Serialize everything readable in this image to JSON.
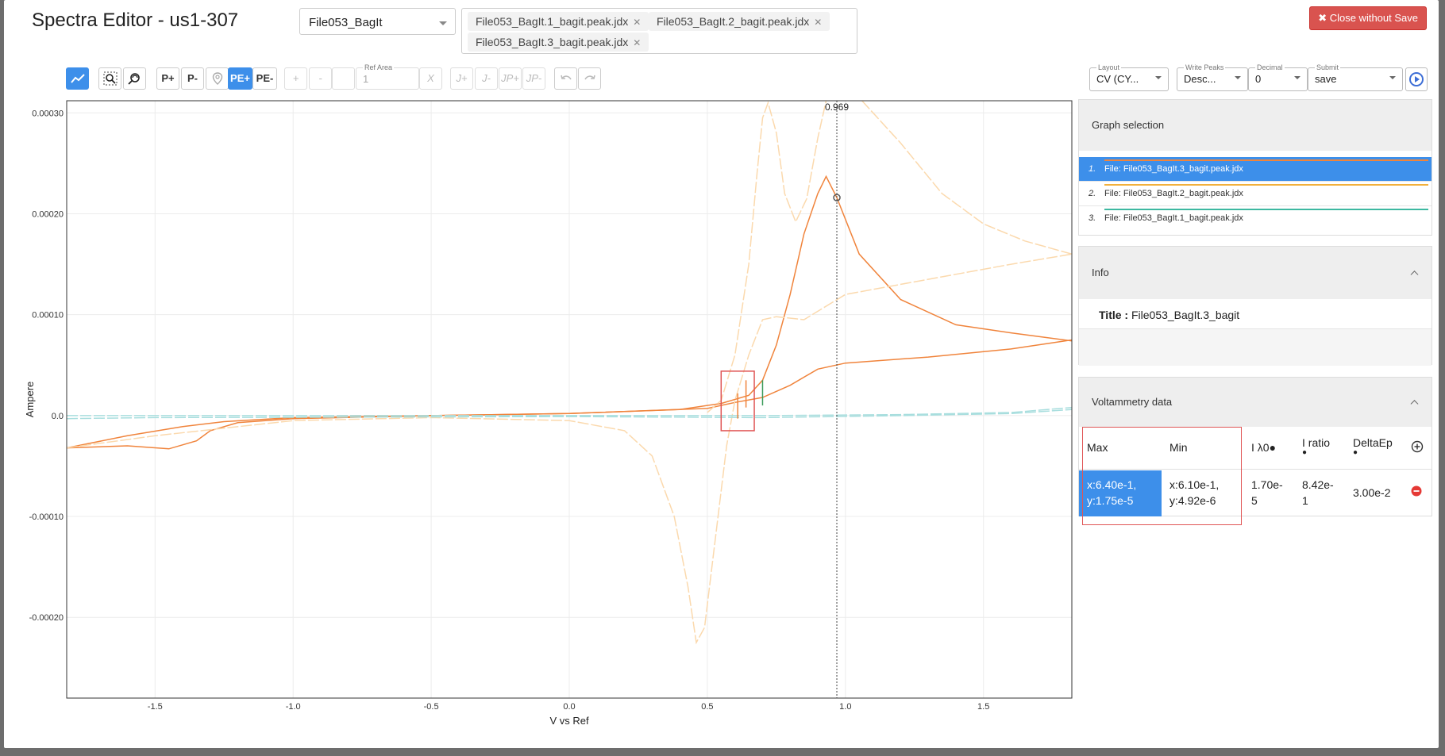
{
  "header": {
    "title": "Spectra Editor - us1-307",
    "close_label": "✖ Close without Save"
  },
  "file_select": {
    "value": "File053_BagIt"
  },
  "files": [
    "File053_BagIt.1_bagit.peak.jdx",
    "File053_BagIt.2_bagit.peak.jdx",
    "File053_BagIt.3_bagit.peak.jdx"
  ],
  "toolbar": {
    "p_plus": "P+",
    "p_minus": "P-",
    "pe_plus": "PE+",
    "pe_minus": "PE-",
    "plus": "+",
    "minus": "-",
    "ref_area_label": "Ref Area",
    "ref_area_value": "1",
    "x_label": "X",
    "j_plus": "J+",
    "j_minus": "J-",
    "jp_plus": "JP+",
    "jp_minus": "JP-"
  },
  "controls": {
    "layout_label": "Layout",
    "layout_value": "CV (CY...",
    "write_peaks_label": "Write Peaks",
    "write_peaks_value": "Desc...",
    "decimal_label": "Decimal",
    "decimal_value": "0",
    "submit_label": "Submit",
    "submit_value": "save"
  },
  "chart_data": {
    "type": "line",
    "xlabel": "V vs Ref",
    "ylabel": "Ampere",
    "xlim": [
      -1.82,
      1.82
    ],
    "ylim": [
      -0.00028,
      0.000312
    ],
    "x_ticks": [
      "-1.5",
      "-1.0",
      "-0.5",
      "0.0",
      "0.5",
      "1.0",
      "1.5"
    ],
    "x_tick_values": [
      -1.5,
      -1.0,
      -0.5,
      0.0,
      0.5,
      1.0,
      1.5
    ],
    "y_ticks": [
      "0.00030",
      "0.00020",
      "0.00010",
      "0.0",
      "-0.00010",
      "-0.00020"
    ],
    "y_tick_values": [
      0.0003,
      0.0002,
      0.0001,
      0.0,
      -0.0001,
      -0.0002
    ],
    "cursor_label": "0.969",
    "cursor_x": 0.969,
    "cursor_point": [
      0.969,
      0.000216
    ],
    "series": [
      {
        "color": "#f0843c",
        "points": [
          [
            -1.82,
            -3.2e-05
          ],
          [
            -1.6,
            -2e-05
          ],
          [
            -1.4,
            -1.1e-05
          ],
          [
            -1.25,
            -6e-06
          ],
          [
            -1.0,
            -2e-06
          ],
          [
            -0.5,
            0.0
          ],
          [
            0.0,
            2e-06
          ],
          [
            0.4,
            6e-06
          ],
          [
            0.55,
            1.2e-05
          ],
          [
            0.65,
            2e-05
          ],
          [
            0.7,
            3.5e-05
          ],
          [
            0.75,
            7e-05
          ],
          [
            0.8,
            0.00012
          ],
          [
            0.85,
            0.00018
          ],
          [
            0.9,
            0.00022
          ],
          [
            0.93,
            0.000237
          ],
          [
            0.969,
            0.000216
          ],
          [
            1.05,
            0.00016
          ],
          [
            1.2,
            0.000115
          ],
          [
            1.4,
            9e-05
          ],
          [
            1.6,
            8.2e-05
          ],
          [
            1.82,
            7.4e-05
          ]
        ]
      },
      {
        "color": "#f0843c",
        "points": [
          [
            -1.82,
            -3.2e-05
          ],
          [
            -1.6,
            -3e-05
          ],
          [
            -1.45,
            -3.3e-05
          ],
          [
            -1.35,
            -2.5e-05
          ],
          [
            -1.3,
            -1.5e-05
          ],
          [
            -1.2,
            -7e-06
          ],
          [
            -1.0,
            -3e-06
          ],
          [
            -0.5,
            0.0
          ],
          [
            0.0,
            2e-06
          ],
          [
            0.5,
            7e-06
          ],
          [
            0.6,
            1.3e-05
          ],
          [
            0.7,
            1.8e-05
          ],
          [
            0.8,
            3e-05
          ],
          [
            0.9,
            4.6e-05
          ],
          [
            1.0,
            5.2e-05
          ],
          [
            1.3,
            5.8e-05
          ],
          [
            1.6,
            6.6e-05
          ],
          [
            1.82,
            7.5e-05
          ]
        ]
      },
      {
        "color": "#fbd9ad",
        "points": [
          [
            -1.82,
            -3.2e-05
          ],
          [
            -1.5,
            -2e-05
          ],
          [
            -1.0,
            -5e-06
          ],
          [
            -0.5,
            -2e-06
          ],
          [
            0.0,
            -5e-06
          ],
          [
            0.2,
            -1.5e-05
          ],
          [
            0.3,
            -4e-05
          ],
          [
            0.38,
            -0.0001
          ],
          [
            0.43,
            -0.00017
          ],
          [
            0.46,
            -0.000225
          ],
          [
            0.49,
            -0.00021
          ],
          [
            0.53,
            -0.00012
          ],
          [
            0.57,
            -3e-05
          ],
          [
            0.6,
            1.5e-05
          ],
          [
            0.65,
            6e-05
          ],
          [
            0.7,
            9.5e-05
          ],
          [
            0.75,
            9.8e-05
          ],
          [
            0.85,
            9.5e-05
          ],
          [
            1.0,
            0.00012
          ],
          [
            1.3,
            0.000135
          ],
          [
            1.6,
            0.00015
          ],
          [
            1.82,
            0.00016
          ]
        ]
      },
      {
        "color": "#fbd9ad",
        "points": [
          [
            0.5,
            3e-06
          ],
          [
            0.55,
            1.5e-05
          ],
          [
            0.6,
            6e-05
          ],
          [
            0.65,
            0.00015
          ],
          [
            0.68,
            0.00024
          ],
          [
            0.7,
            0.000295
          ],
          [
            0.72,
            0.00031
          ],
          [
            0.75,
            0.00028
          ],
          [
            0.78,
            0.00022
          ],
          [
            0.82,
            0.000192
          ],
          [
            0.86,
            0.000215
          ],
          [
            0.9,
            0.000275
          ],
          [
            0.93,
            0.000312
          ]
        ]
      },
      {
        "color": "#fbd9ad",
        "points": [
          [
            1.06,
            0.000312
          ],
          [
            1.2,
            0.00027
          ],
          [
            1.35,
            0.00022
          ],
          [
            1.5,
            0.00019
          ],
          [
            1.65,
            0.000173
          ],
          [
            1.82,
            0.00016
          ]
        ]
      },
      {
        "color": "#a8dede",
        "points": [
          [
            -1.82,
            0.0
          ],
          [
            -1.5,
            0.0
          ],
          [
            0.0,
            0.0
          ],
          [
            0.7,
            0.0
          ],
          [
            1.2,
            1e-06
          ],
          [
            1.6,
            3e-06
          ],
          [
            1.82,
            8e-06
          ]
        ]
      },
      {
        "color": "#a8dede",
        "points": [
          [
            -1.82,
            -3e-06
          ],
          [
            -1.5,
            -2e-06
          ],
          [
            0.0,
            -1e-06
          ],
          [
            0.7,
            -2e-06
          ],
          [
            1.2,
            0.0
          ],
          [
            1.6,
            2e-06
          ],
          [
            1.82,
            6e-06
          ]
        ]
      }
    ],
    "peak_marks": [
      {
        "x": 0.61,
        "y_range": [
          -3e-06,
          2.2e-05
        ],
        "color": "#f0843c"
      },
      {
        "x": 0.64,
        "y_range": [
          8e-06,
          3.5e-05
        ],
        "color": "#f0843c"
      },
      {
        "x": 0.7,
        "y_range": [
          1e-05,
          3.5e-05
        ],
        "color": "#3a9a5a"
      }
    ],
    "highlight_box": {
      "x_range": [
        0.55,
        0.67
      ],
      "y_range": [
        -1.5e-05,
        4.4e-05
      ]
    }
  },
  "graph_selection": {
    "title": "Graph selection",
    "items": [
      {
        "num": "1.",
        "label": "File: File053_BagIt.3_bagit.peak.jdx",
        "color": "#f0843c"
      },
      {
        "num": "2.",
        "label": "File: File053_BagIt.2_bagit.peak.jdx",
        "color": "#f2b13c"
      },
      {
        "num": "3.",
        "label": "File: File053_BagIt.1_bagit.peak.jdx",
        "color": "#3db8a0"
      }
    ]
  },
  "info": {
    "title": "Info",
    "title_key": "Title :",
    "title_value": "File053_BagIt.3_bagit"
  },
  "voltammetry": {
    "title": "Voltammetry data",
    "headers": {
      "max": "Max",
      "min": "Min",
      "i_lambda": "I λ0●",
      "i_ratio": "I ratio",
      "delta_ep": "DeltaEp",
      "dot": "●"
    },
    "row": {
      "max_1": "x:6.40e-1,",
      "max_2": "y:1.75e-5",
      "min_1": "x:6.10e-1,",
      "min_2": "y:4.92e-6",
      "il_1": "1.70e-",
      "il_2": "5",
      "ir_1": "8.42e-",
      "ir_2": "1",
      "dep": "3.00e-2"
    }
  }
}
